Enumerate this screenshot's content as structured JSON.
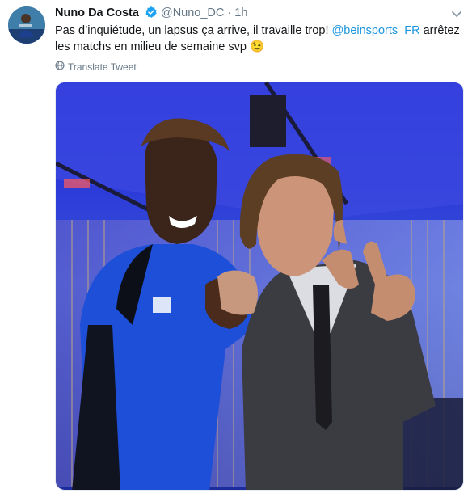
{
  "tweet": {
    "author_name": "Nuno Da Costa",
    "handle": "@Nuno_DC",
    "separator": "·",
    "time": "1h",
    "text_part1": "Pas d’inquiétude, un lapsus ça arrive, il travaille trop!",
    "mention": "@beinsports_FR",
    "text_part2": " arrêtez les matchs en milieu de semaine svp",
    "emoji": "😉",
    "translate_label": "Translate Tweet"
  },
  "colors": {
    "link": "#1b95e0",
    "secondary_text": "#657786",
    "verified_badge": "#1da1f2"
  },
  "icons": {
    "verified": "verified-badge-icon",
    "menu": "chevron-down-icon",
    "translate": "globe-icon"
  }
}
